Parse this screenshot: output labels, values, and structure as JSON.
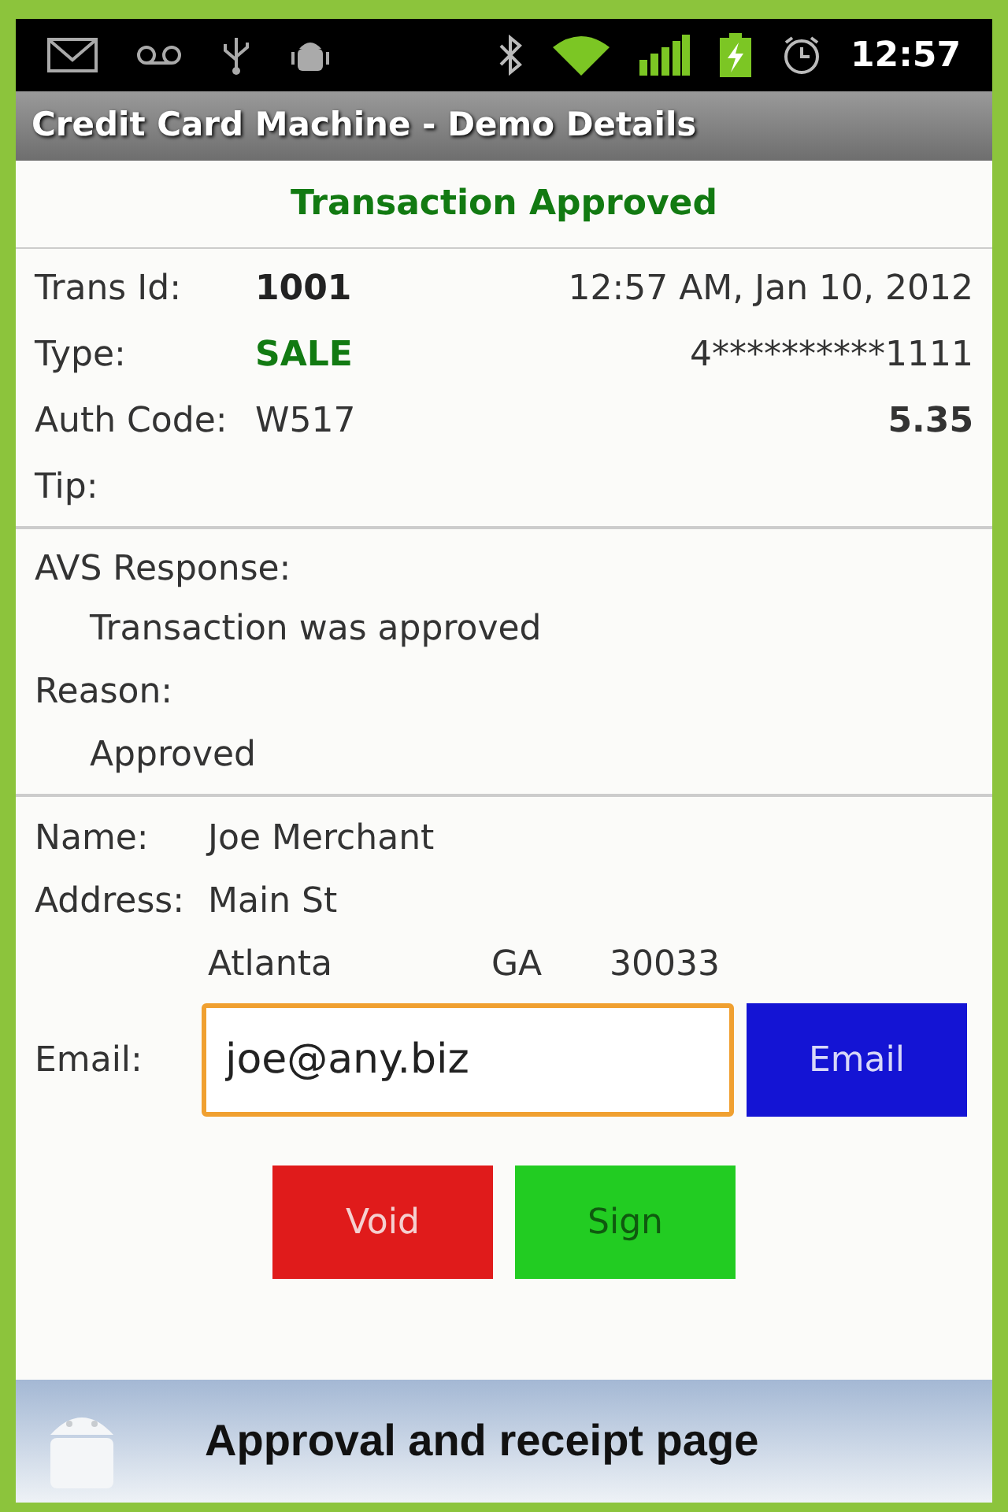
{
  "status_bar": {
    "time": "12:57"
  },
  "window": {
    "title": "Credit Card Machine - Demo Details"
  },
  "banner": "Transaction Approved",
  "summary": {
    "trans_id_label": "Trans Id:",
    "trans_id": "1001",
    "datetime": "12:57 AM, Jan 10, 2012",
    "type_label": "Type:",
    "type": "SALE",
    "card": "4**********1111",
    "auth_label": "Auth Code:",
    "auth": "W517",
    "amount": "5.35",
    "tip_label": "Tip:"
  },
  "response": {
    "avs_label": "AVS Response:",
    "avs": "Transaction was approved",
    "reason_label": "Reason:",
    "reason": "Approved"
  },
  "customer": {
    "name_label": "Name:",
    "name": "Joe Merchant",
    "address_label": "Address:",
    "street": "Main St",
    "city": "Atlanta",
    "state": "GA",
    "zip": "30033",
    "email_label": "Email:",
    "email": "joe@any.biz",
    "email_focused": true,
    "email_button": "Email"
  },
  "buttons": [
    {
      "label": "Void",
      "kind": "void"
    },
    {
      "label": "Sign",
      "kind": "sign"
    }
  ],
  "caption": "Approval and receipt page"
}
